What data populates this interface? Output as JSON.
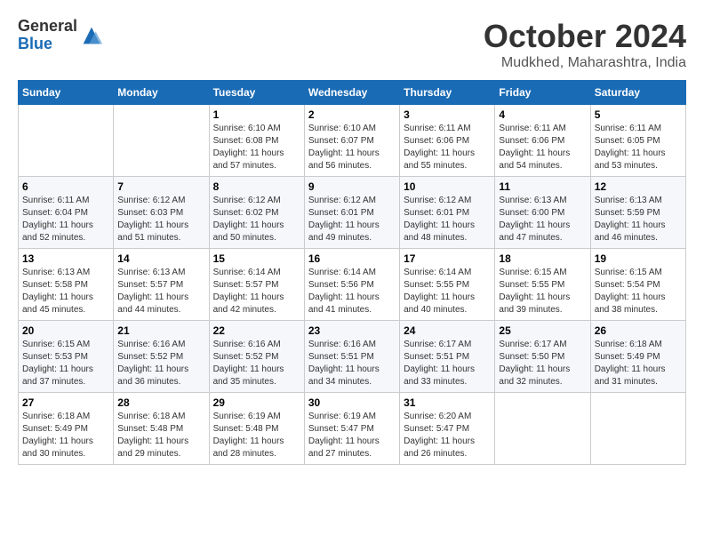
{
  "logo": {
    "general": "General",
    "blue": "Blue"
  },
  "title": "October 2024",
  "location": "Mudkhed, Maharashtra, India",
  "days_of_week": [
    "Sunday",
    "Monday",
    "Tuesday",
    "Wednesday",
    "Thursday",
    "Friday",
    "Saturday"
  ],
  "weeks": [
    [
      {
        "day": "",
        "sunrise": "",
        "sunset": "",
        "daylight": ""
      },
      {
        "day": "",
        "sunrise": "",
        "sunset": "",
        "daylight": ""
      },
      {
        "day": "1",
        "sunrise": "Sunrise: 6:10 AM",
        "sunset": "Sunset: 6:08 PM",
        "daylight": "Daylight: 11 hours and 57 minutes."
      },
      {
        "day": "2",
        "sunrise": "Sunrise: 6:10 AM",
        "sunset": "Sunset: 6:07 PM",
        "daylight": "Daylight: 11 hours and 56 minutes."
      },
      {
        "day": "3",
        "sunrise": "Sunrise: 6:11 AM",
        "sunset": "Sunset: 6:06 PM",
        "daylight": "Daylight: 11 hours and 55 minutes."
      },
      {
        "day": "4",
        "sunrise": "Sunrise: 6:11 AM",
        "sunset": "Sunset: 6:06 PM",
        "daylight": "Daylight: 11 hours and 54 minutes."
      },
      {
        "day": "5",
        "sunrise": "Sunrise: 6:11 AM",
        "sunset": "Sunset: 6:05 PM",
        "daylight": "Daylight: 11 hours and 53 minutes."
      }
    ],
    [
      {
        "day": "6",
        "sunrise": "Sunrise: 6:11 AM",
        "sunset": "Sunset: 6:04 PM",
        "daylight": "Daylight: 11 hours and 52 minutes."
      },
      {
        "day": "7",
        "sunrise": "Sunrise: 6:12 AM",
        "sunset": "Sunset: 6:03 PM",
        "daylight": "Daylight: 11 hours and 51 minutes."
      },
      {
        "day": "8",
        "sunrise": "Sunrise: 6:12 AM",
        "sunset": "Sunset: 6:02 PM",
        "daylight": "Daylight: 11 hours and 50 minutes."
      },
      {
        "day": "9",
        "sunrise": "Sunrise: 6:12 AM",
        "sunset": "Sunset: 6:01 PM",
        "daylight": "Daylight: 11 hours and 49 minutes."
      },
      {
        "day": "10",
        "sunrise": "Sunrise: 6:12 AM",
        "sunset": "Sunset: 6:01 PM",
        "daylight": "Daylight: 11 hours and 48 minutes."
      },
      {
        "day": "11",
        "sunrise": "Sunrise: 6:13 AM",
        "sunset": "Sunset: 6:00 PM",
        "daylight": "Daylight: 11 hours and 47 minutes."
      },
      {
        "day": "12",
        "sunrise": "Sunrise: 6:13 AM",
        "sunset": "Sunset: 5:59 PM",
        "daylight": "Daylight: 11 hours and 46 minutes."
      }
    ],
    [
      {
        "day": "13",
        "sunrise": "Sunrise: 6:13 AM",
        "sunset": "Sunset: 5:58 PM",
        "daylight": "Daylight: 11 hours and 45 minutes."
      },
      {
        "day": "14",
        "sunrise": "Sunrise: 6:13 AM",
        "sunset": "Sunset: 5:57 PM",
        "daylight": "Daylight: 11 hours and 44 minutes."
      },
      {
        "day": "15",
        "sunrise": "Sunrise: 6:14 AM",
        "sunset": "Sunset: 5:57 PM",
        "daylight": "Daylight: 11 hours and 42 minutes."
      },
      {
        "day": "16",
        "sunrise": "Sunrise: 6:14 AM",
        "sunset": "Sunset: 5:56 PM",
        "daylight": "Daylight: 11 hours and 41 minutes."
      },
      {
        "day": "17",
        "sunrise": "Sunrise: 6:14 AM",
        "sunset": "Sunset: 5:55 PM",
        "daylight": "Daylight: 11 hours and 40 minutes."
      },
      {
        "day": "18",
        "sunrise": "Sunrise: 6:15 AM",
        "sunset": "Sunset: 5:55 PM",
        "daylight": "Daylight: 11 hours and 39 minutes."
      },
      {
        "day": "19",
        "sunrise": "Sunrise: 6:15 AM",
        "sunset": "Sunset: 5:54 PM",
        "daylight": "Daylight: 11 hours and 38 minutes."
      }
    ],
    [
      {
        "day": "20",
        "sunrise": "Sunrise: 6:15 AM",
        "sunset": "Sunset: 5:53 PM",
        "daylight": "Daylight: 11 hours and 37 minutes."
      },
      {
        "day": "21",
        "sunrise": "Sunrise: 6:16 AM",
        "sunset": "Sunset: 5:52 PM",
        "daylight": "Daylight: 11 hours and 36 minutes."
      },
      {
        "day": "22",
        "sunrise": "Sunrise: 6:16 AM",
        "sunset": "Sunset: 5:52 PM",
        "daylight": "Daylight: 11 hours and 35 minutes."
      },
      {
        "day": "23",
        "sunrise": "Sunrise: 6:16 AM",
        "sunset": "Sunset: 5:51 PM",
        "daylight": "Daylight: 11 hours and 34 minutes."
      },
      {
        "day": "24",
        "sunrise": "Sunrise: 6:17 AM",
        "sunset": "Sunset: 5:51 PM",
        "daylight": "Daylight: 11 hours and 33 minutes."
      },
      {
        "day": "25",
        "sunrise": "Sunrise: 6:17 AM",
        "sunset": "Sunset: 5:50 PM",
        "daylight": "Daylight: 11 hours and 32 minutes."
      },
      {
        "day": "26",
        "sunrise": "Sunrise: 6:18 AM",
        "sunset": "Sunset: 5:49 PM",
        "daylight": "Daylight: 11 hours and 31 minutes."
      }
    ],
    [
      {
        "day": "27",
        "sunrise": "Sunrise: 6:18 AM",
        "sunset": "Sunset: 5:49 PM",
        "daylight": "Daylight: 11 hours and 30 minutes."
      },
      {
        "day": "28",
        "sunrise": "Sunrise: 6:18 AM",
        "sunset": "Sunset: 5:48 PM",
        "daylight": "Daylight: 11 hours and 29 minutes."
      },
      {
        "day": "29",
        "sunrise": "Sunrise: 6:19 AM",
        "sunset": "Sunset: 5:48 PM",
        "daylight": "Daylight: 11 hours and 28 minutes."
      },
      {
        "day": "30",
        "sunrise": "Sunrise: 6:19 AM",
        "sunset": "Sunset: 5:47 PM",
        "daylight": "Daylight: 11 hours and 27 minutes."
      },
      {
        "day": "31",
        "sunrise": "Sunrise: 6:20 AM",
        "sunset": "Sunset: 5:47 PM",
        "daylight": "Daylight: 11 hours and 26 minutes."
      },
      {
        "day": "",
        "sunrise": "",
        "sunset": "",
        "daylight": ""
      },
      {
        "day": "",
        "sunrise": "",
        "sunset": "",
        "daylight": ""
      }
    ]
  ]
}
